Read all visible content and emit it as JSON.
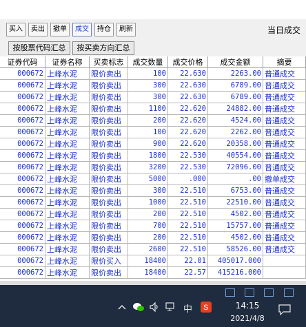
{
  "toolbar": {
    "buttons": [
      "买入",
      "卖出",
      "撤单",
      "成交",
      "持仓",
      "刷新"
    ],
    "active_label": "成交",
    "title_right": "当日成交"
  },
  "summary_buttons": [
    "按股票代码汇总",
    "按买卖方向汇总"
  ],
  "table": {
    "headers": [
      "证券代码",
      "证券名称",
      "买卖标志",
      "成交数量",
      "成交价格",
      "成交金额",
      "摘要"
    ],
    "rows": [
      [
        "000672",
        "上峰水泥",
        "限价卖出",
        "100",
        "22.630",
        "2263.00",
        "普通成交"
      ],
      [
        "000672",
        "上峰水泥",
        "限价卖出",
        "300",
        "22.630",
        "6789.00",
        "普通成交"
      ],
      [
        "000672",
        "上峰水泥",
        "限价卖出",
        "300",
        "22.630",
        "6789.00",
        "普通成交"
      ],
      [
        "000672",
        "上峰水泥",
        "限价卖出",
        "1100",
        "22.620",
        "24882.00",
        "普通成交"
      ],
      [
        "000672",
        "上峰水泥",
        "限价卖出",
        "200",
        "22.620",
        "4524.00",
        "普通成交"
      ],
      [
        "000672",
        "上峰水泥",
        "限价卖出",
        "100",
        "22.620",
        "2262.00",
        "普通成交"
      ],
      [
        "000672",
        "上峰水泥",
        "限价卖出",
        "900",
        "22.620",
        "20358.00",
        "普通成交"
      ],
      [
        "000672",
        "上峰水泥",
        "限价卖出",
        "1800",
        "22.530",
        "40554.00",
        "普通成交"
      ],
      [
        "000672",
        "上峰水泥",
        "限价卖出",
        "3200",
        "22.530",
        "72096.00",
        "普通成交"
      ],
      [
        "000672",
        "上峰水泥",
        "限价卖出",
        "5000",
        ".000",
        ".00",
        "撤单成交"
      ],
      [
        "000672",
        "上峰水泥",
        "限价卖出",
        "300",
        "22.510",
        "6753.00",
        "普通成交"
      ],
      [
        "000672",
        "上峰水泥",
        "限价卖出",
        "1000",
        "22.510",
        "22510.00",
        "普通成交"
      ],
      [
        "000672",
        "上峰水泥",
        "限价卖出",
        "200",
        "22.510",
        "4502.00",
        "普通成交"
      ],
      [
        "000672",
        "上峰水泥",
        "限价卖出",
        "700",
        "22.510",
        "15757.00",
        "普通成交"
      ],
      [
        "000672",
        "上峰水泥",
        "限价卖出",
        "200",
        "22.510",
        "4502.00",
        "普通成交"
      ],
      [
        "000672",
        "上峰水泥",
        "限价卖出",
        "2600",
        "22.510",
        "58526.00",
        "普通成交"
      ],
      [
        "000672",
        "上峰水泥",
        "限价买入",
        "18400",
        "22.01",
        "405017.000",
        ""
      ],
      [
        "000672",
        "上峰水泥",
        "限价卖出",
        "18400",
        "22.57",
        "415216.000",
        ""
      ]
    ]
  },
  "taskbar": {
    "ime_label": "中",
    "time": "14:15",
    "date": "2021/4/8",
    "icons": [
      "chevron-up-icon",
      "wechat-icon",
      "volume-icon",
      "network-icon",
      "ime-icon",
      "sogou-icon",
      "notification-icon"
    ]
  },
  "colors": {
    "table_text": "#1a2fd0",
    "taskbar_bg": "#1f2b3e",
    "active_button": "#1a3fd0"
  }
}
